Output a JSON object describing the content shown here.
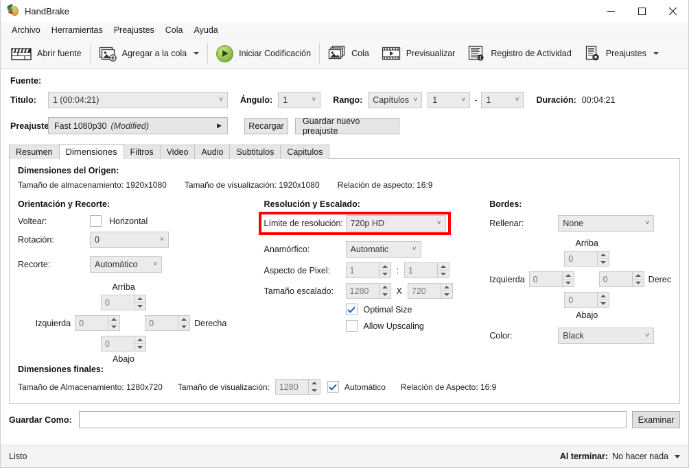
{
  "window": {
    "title": "HandBrake",
    "app_icon": "handbrake-pineapple-icon",
    "minimize": "─",
    "maximize": "□",
    "close": "✕"
  },
  "menubar": {
    "items": [
      "Archivo",
      "Herramientas",
      "Preajustes",
      "Cola",
      "Ayuda"
    ]
  },
  "toolbar": {
    "open_source": "Abrir fuente",
    "add_to_queue": "Agregar a la cola",
    "start_encode": "Iniciar Codificación",
    "queue": "Cola",
    "preview": "Previsualizar",
    "activity_log": "Registro de Actividad",
    "presets": "Preajustes"
  },
  "source": {
    "source_label": "Fuente:",
    "title_label": "Titulo:",
    "title_value": "1  (00:04:21)",
    "angle_label": "Ángulo:",
    "angle_value": "1",
    "range_label": "Rango:",
    "range_value": "Capítulos",
    "chapter_start": "1",
    "range_dash": "-",
    "chapter_end": "1",
    "duration_label": "Duración:",
    "duration_value": "00:04:21"
  },
  "preset": {
    "label": "Preajuste:",
    "value": "Fast 1080p30",
    "modified": "(Modified)",
    "reload": "Recargar",
    "save_new": "Guardar nuevo preajuste"
  },
  "tabs": {
    "items": [
      {
        "label": "Resumen",
        "active": false
      },
      {
        "label": "Dimensiones",
        "active": true
      },
      {
        "label": "Filtros",
        "active": false
      },
      {
        "label": "Video",
        "active": false
      },
      {
        "label": "Audio",
        "active": false
      },
      {
        "label": "Subtitulos",
        "active": false
      },
      {
        "label": "Capitulos",
        "active": false
      }
    ]
  },
  "dimensions": {
    "source_section_title": "Dimensiones del Origen:",
    "storage_size": "Tamaño de almacenamiento: 1920x1080",
    "display_size": "Tamaño de visualización: 1920x1080",
    "aspect_ratio": "Relación de aspecto: 16:9",
    "orientation_title": "Orientación y Recorte:",
    "flip_label": "Voltear:",
    "flip_horizontal": "Horizontal",
    "flip_checked": false,
    "rotation_label": "Rotación:",
    "rotation_value": "0",
    "crop_label": "Recorte:",
    "crop_value": "Automático",
    "crop_top_label": "Arriba",
    "crop_top_value": "0",
    "crop_left_label": "Izquierda",
    "crop_left_value": "0",
    "crop_right_label": "Derecha",
    "crop_right_value": "0",
    "crop_bottom_label": "Abajo",
    "crop_bottom_value": "0",
    "resolution_title": "Resolución y Escalado:",
    "res_limit_label": "Límite de resolución:",
    "res_limit_value": "720p HD",
    "anamorphic_label": "Anamórfico:",
    "anamorphic_value": "Automatic",
    "pixel_aspect_label": "Aspecto de Pixel:",
    "pixel_aspect_num": "1",
    "pixel_aspect_sep": ":",
    "pixel_aspect_den": "1",
    "scaled_size_label": "Tamaño escalado:",
    "scaled_width": "1280",
    "scaled_sep": "X",
    "scaled_height": "720",
    "optimal_size_label": "Optimal Size",
    "optimal_size_checked": true,
    "allow_upscaling_label": "Allow Upscaling",
    "allow_upscaling_checked": false,
    "borders_title": "Bordes:",
    "pad_label": "Rellenar:",
    "pad_value": "None",
    "pad_top_label": "Arriba",
    "pad_top_value": "0",
    "pad_left_label": "Izquierda",
    "pad_left_value": "0",
    "pad_right_label": "Derec",
    "pad_right_value": "0",
    "pad_bottom_label": "Abajo",
    "pad_bottom_value": "0",
    "color_label": "Color:",
    "color_value": "Black",
    "final_title": "Dimensiones finales:",
    "final_storage": "Tamaño de Almacenamiento: 1280x720",
    "final_display_label": "Tamaño de visualización:",
    "final_display_value": "1280",
    "final_auto_label": "Automático",
    "final_auto_checked": true,
    "final_aspect": "Relación de Aspecto: 16:9"
  },
  "save_as": {
    "label": "Guardar Como:",
    "value": "",
    "placeholder": "",
    "browse": "Examinar"
  },
  "statusbar": {
    "status": "Listo",
    "when_done_label": "Al terminar:",
    "when_done_value": "No hacer nada"
  },
  "colors": {
    "highlight": "#ff0000",
    "accent_green": "#8fbf4d",
    "window_bg": "#ffffff",
    "toolbar_bg": "#f7f7f7",
    "control_bg": "#ebebeb"
  }
}
